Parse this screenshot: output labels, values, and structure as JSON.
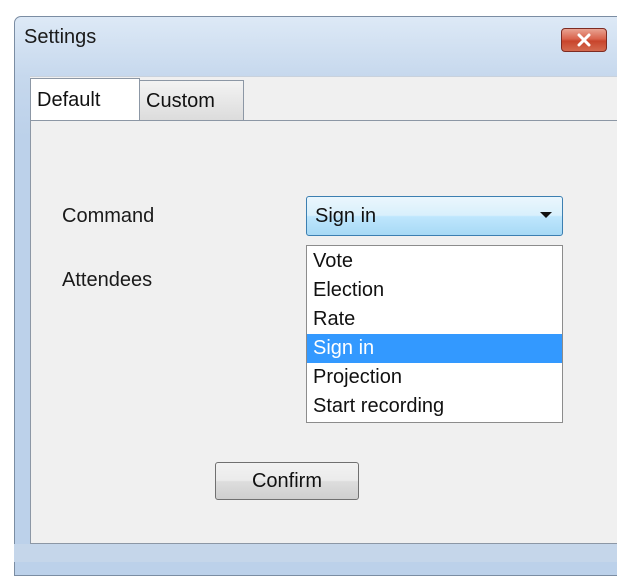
{
  "window": {
    "title": "Settings",
    "close_icon": "close-icon",
    "accent_close": "#c8452c"
  },
  "tabs": [
    {
      "label": "Default",
      "active": true
    },
    {
      "label": "Custom",
      "active": false
    }
  ],
  "form": {
    "command_label": "Command",
    "attendees_label": "Attendees",
    "command_value": "Sign in",
    "command_options": [
      "Vote",
      "Election",
      "Rate",
      "Sign in",
      "Projection",
      "Start recording"
    ],
    "selected_option": "Sign in",
    "highlight_color": "#3399ff"
  },
  "actions": {
    "confirm_label": "Confirm"
  }
}
